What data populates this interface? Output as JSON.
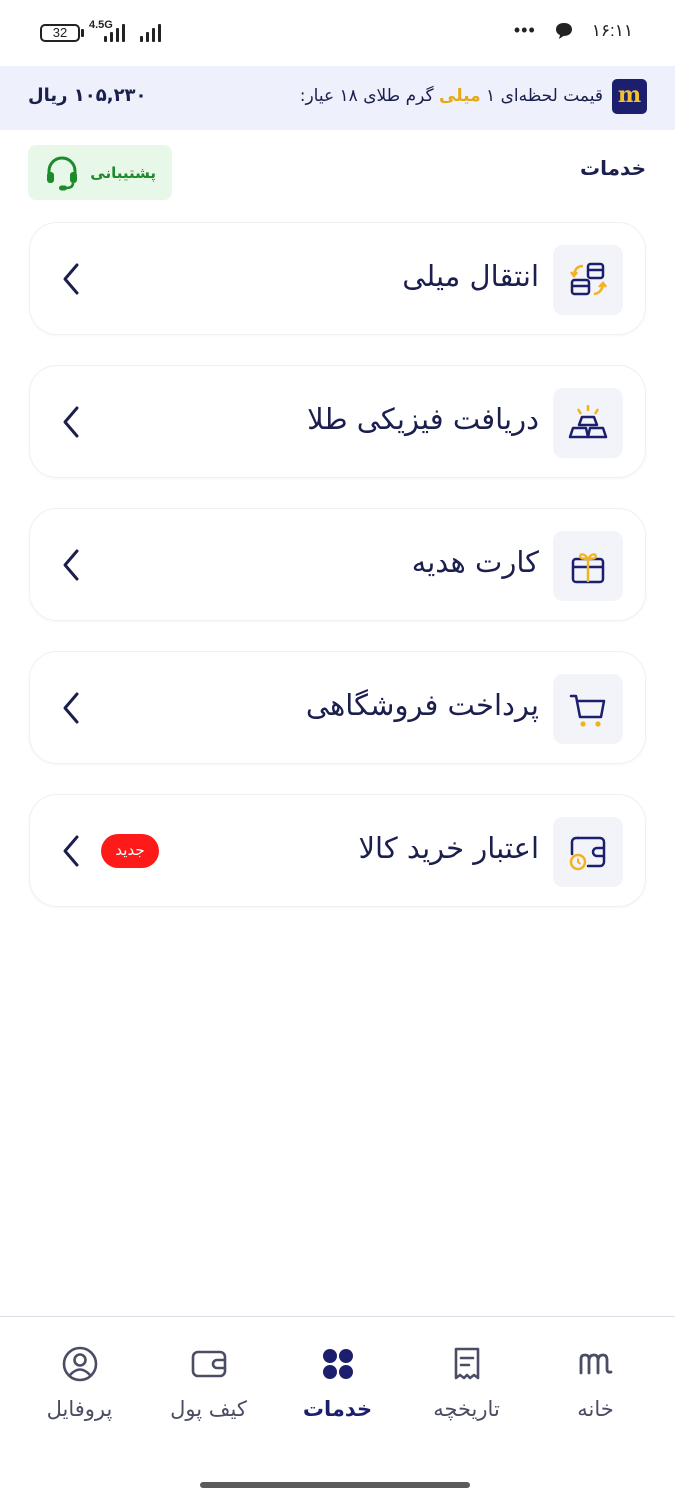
{
  "status_bar": {
    "battery": "32",
    "network": "4.5G",
    "time": "۱۶:۱۱",
    "dots": "•••"
  },
  "price_bar": {
    "label_prefix": "قیمت لحظه‌ای ۱ ",
    "label_highlight": "میلی",
    "label_suffix": " گرم طلای ۱۸ عیار:",
    "value": "۱۰۵,۲۳۰ ریال",
    "logo": "m",
    "accent_color": "#e6a817",
    "brand_color": "#1b1f6e"
  },
  "header": {
    "title": "خدمات",
    "support_label": "پشتیبانی",
    "support_icon": "headset-icon",
    "support_color": "#1d8a2b"
  },
  "services": [
    {
      "title": "انتقال میلی",
      "icon": "transfer-icon"
    },
    {
      "title": "دریافت فیزیکی طلا",
      "icon": "gold-bars-icon"
    },
    {
      "title": "کارت هدیه",
      "icon": "gift-card-icon"
    },
    {
      "title": "پرداخت فروشگاهی",
      "icon": "shopping-cart-icon"
    },
    {
      "title": "اعتبار خرید کالا",
      "icon": "credit-wallet-icon",
      "badge": "جدید",
      "badge_color": "#ff1a1a"
    }
  ],
  "bottom_nav": {
    "active": "خدمات",
    "items": [
      {
        "label": "خانه",
        "icon": "home-logo-icon"
      },
      {
        "label": "تاریخچه",
        "icon": "receipt-icon"
      },
      {
        "label": "خدمات",
        "icon": "grid-icon"
      },
      {
        "label": "کیف پول",
        "icon": "wallet-icon"
      },
      {
        "label": "پروفایل",
        "icon": "user-icon"
      }
    ]
  }
}
